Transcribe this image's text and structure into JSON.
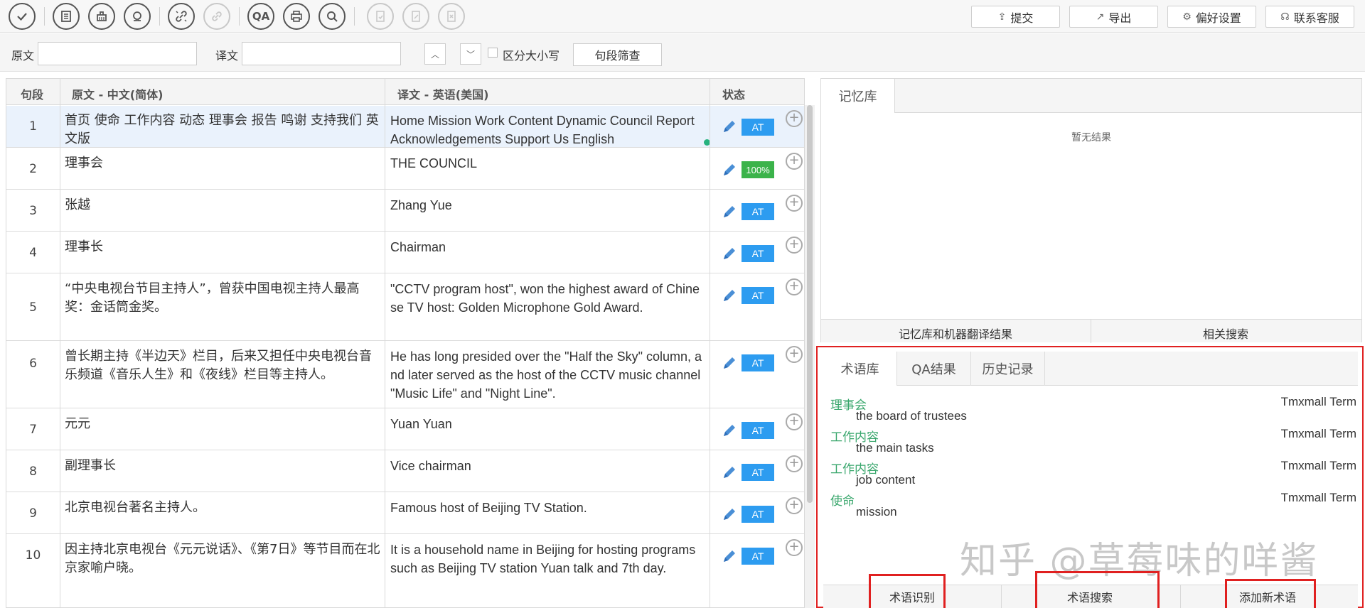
{
  "toolbar": {
    "icons": [
      "check-icon",
      "document-icon",
      "cleanup-icon",
      "omega-icon",
      "unlink-icon",
      "link-icon",
      "qa-icon",
      "print-icon",
      "search-icon",
      "doc-confirm-icon",
      "doc-edit-icon",
      "doc-close-icon"
    ],
    "qa_label": "QA",
    "buttons": [
      {
        "label": "提交",
        "icon": "upload-icon"
      },
      {
        "label": "导出",
        "icon": "export-icon"
      },
      {
        "label": "偏好设置",
        "icon": "gear-icon"
      },
      {
        "label": "联系客服",
        "icon": "headset-icon"
      }
    ]
  },
  "filter": {
    "source_label": "原文",
    "target_label": "译文",
    "source_value": "",
    "target_value": "",
    "case_label": "区分大小写",
    "filter_button": "句段筛查"
  },
  "grid": {
    "headers": {
      "num": "句段",
      "source": "原文 - 中文(简体)",
      "target": "译文 - 英语(美国)",
      "status": "状态"
    },
    "rows": [
      {
        "num": "1",
        "source": "首页 使命 工作内容 动态 理事会 报告 鸣谢 支持我们 英文版",
        "target": " Home Mission Work Content Dynamic Council Report Acknowledgements Support Us English",
        "status": "AT"
      },
      {
        "num": "2",
        "source": "理事会",
        "target": "THE COUNCIL",
        "status": "100%"
      },
      {
        "num": "3",
        "source": "张越",
        "target": "Zhang Yue",
        "status": "AT"
      },
      {
        "num": "4",
        "source": "理事长",
        "target": "Chairman",
        "status": "AT"
      },
      {
        "num": "5",
        "source": "“中央电视台节目主持人”，曾获中国电视主持人最高奖：金话筒金奖。",
        "target": "\"CCTV program host\", won the highest award of Chinese TV host: Golden Microphone Gold Award.",
        "status": "AT"
      },
      {
        "num": "6",
        "source": "曾长期主持《半边天》栏目，后来又担任中央电视台音乐频道《音乐人生》和《夜线》栏目等主持人。",
        "target": "He has long presided over the \"Half the Sky\" column, and later served as the host of the CCTV music channel \"Music Life\" and \"Night Line\".",
        "status": "AT"
      },
      {
        "num": "7",
        "source": "元元",
        "target": "Yuan Yuan",
        "status": "AT"
      },
      {
        "num": "8",
        "source": "副理事长",
        "target": "Vice chairman",
        "status": "AT"
      },
      {
        "num": "9",
        "source": "北京电视台著名主持人。",
        "target": "Famous host of Beijing TV Station.",
        "status": "AT"
      },
      {
        "num": "10",
        "source": "因主持北京电视台《元元说话》、《第7日》等节目而在北京家喻户晓。",
        "target": "It is a household name in Beijing for hosting programs such as Beijing TV station Yuan talk and 7th day.",
        "status": "AT"
      }
    ]
  },
  "memory": {
    "tab": "记忆库",
    "empty": "暂无结果",
    "footer_left": "记忆库和机器翻译结果",
    "footer_right": "相关搜索"
  },
  "terms": {
    "tabs": [
      "术语库",
      "QA结果",
      "历史记录"
    ],
    "items": [
      {
        "source": "理事会",
        "target": "the board of trustees",
        "from": "Tmxmall Term"
      },
      {
        "source": "工作内容",
        "target": "the main tasks",
        "from": "Tmxmall Term"
      },
      {
        "source": "工作内容",
        "target": "job content",
        "from": "Tmxmall Term"
      },
      {
        "source": "使命",
        "target": "mission",
        "from": "Tmxmall Term"
      }
    ],
    "watermark": "知乎 @草莓味的咩酱",
    "footer": [
      "术语识别",
      "术语搜索",
      "添加新术语"
    ]
  },
  "colors": {
    "accent": "#2d9cf0",
    "full_match": "#3bb34a",
    "term_source": "#3aa76d",
    "highlight": "#e02020"
  }
}
